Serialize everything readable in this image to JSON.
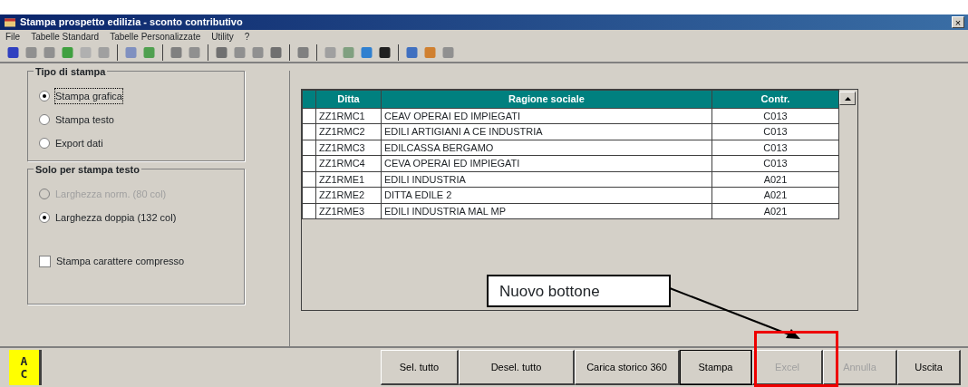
{
  "window": {
    "title": "Stampa prospetto edilizia - sconto contributivo",
    "close": "×"
  },
  "menu": [
    "File",
    "Tabelle Standard",
    "Tabelle Personalizzate",
    "Utility",
    "?"
  ],
  "print_type": {
    "title": "Tipo di stampa",
    "options": [
      {
        "label": "Stampa grafica",
        "selected": true,
        "disabled": false
      },
      {
        "label": "Stampa testo",
        "selected": false,
        "disabled": false
      },
      {
        "label": "Export dati",
        "selected": false,
        "disabled": false
      }
    ]
  },
  "text_only": {
    "title": "Solo per stampa testo",
    "options": [
      {
        "label": "Larghezza norm. (80 col)",
        "selected": false,
        "disabled": true
      },
      {
        "label": "Larghezza doppia (132 col)",
        "selected": true,
        "disabled": false
      }
    ],
    "compressed": {
      "label": "Stampa carattere compresso",
      "checked": false
    }
  },
  "table": {
    "columns": [
      "Ditta",
      "Ragione sociale",
      "Contr."
    ],
    "rows": [
      [
        "ZZ1RMC1",
        "CEAV OPERAI ED IMPIEGATI",
        "C013"
      ],
      [
        "ZZ1RMC2",
        "EDILI ARTIGIANI A CE INDUSTRIA",
        "C013"
      ],
      [
        "ZZ1RMC3",
        "EDILCASSA BERGAMO",
        "C013"
      ],
      [
        "ZZ1RMC4",
        "CEVA OPERAI ED IMPIEGATI",
        "C013"
      ],
      [
        "ZZ1RME1",
        "EDILI INDUSTRIA",
        "A021"
      ],
      [
        "ZZ1RME2",
        "DITTA EDILE 2",
        "A021"
      ],
      [
        "ZZ1RME3",
        "EDILI INDUSTRIA MAL MP",
        "A021"
      ]
    ]
  },
  "logo": [
    "A",
    "C"
  ],
  "buttons": [
    {
      "label": "Sel. tutto",
      "disabled": false,
      "default": false
    },
    {
      "label": "Desel. tutto",
      "disabled": false,
      "default": false
    },
    {
      "label": "Carica storico 360",
      "disabled": false,
      "default": false
    },
    {
      "label": "Stampa",
      "disabled": false,
      "default": true
    },
    {
      "label": "Excel",
      "disabled": true,
      "default": false
    },
    {
      "label": "Annulla",
      "disabled": true,
      "default": false
    },
    {
      "label": "Uscita",
      "disabled": false,
      "default": false
    }
  ],
  "annotation": {
    "text": "Nuovo bottone"
  }
}
